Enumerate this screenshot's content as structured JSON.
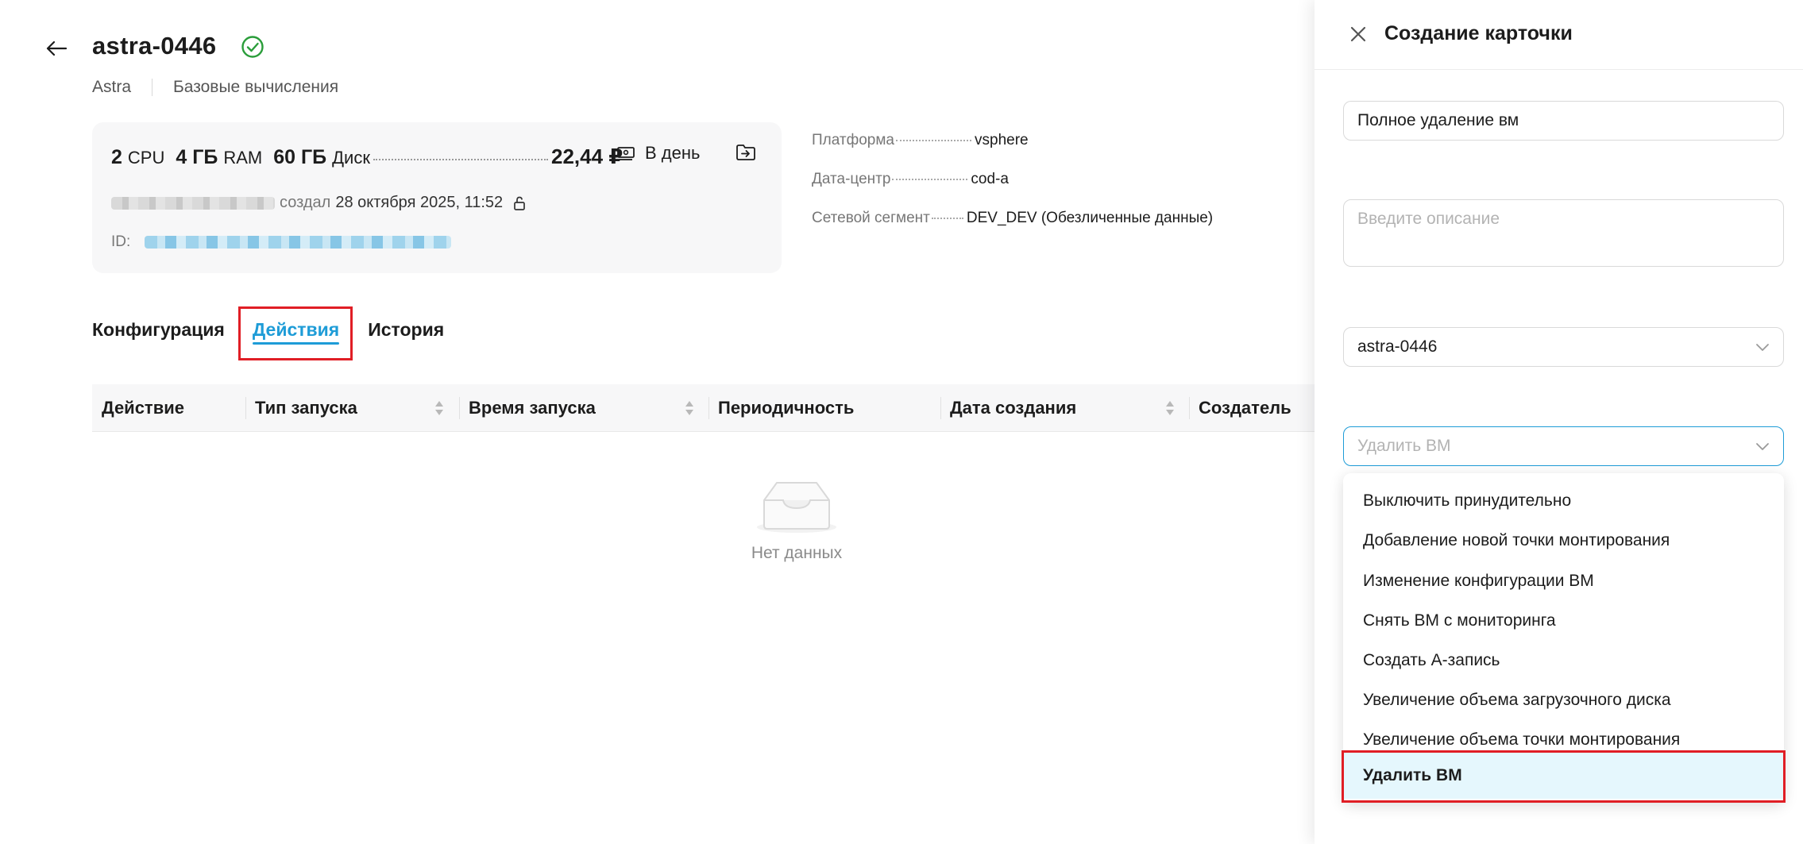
{
  "header": {
    "title": "astra-0446",
    "breadcrumb": [
      "Astra",
      "Базовые вычисления"
    ]
  },
  "card": {
    "cpu_value": "2",
    "cpu_unit": "CPU",
    "ram_value": "4 ГБ",
    "ram_unit": "RAM",
    "disk_value": "60 ГБ",
    "disk_unit": "Диск",
    "price": "22,44 ₽",
    "period": "В день",
    "created_label": "создал",
    "created_date": "28 октября 2025, 11:52",
    "id_label": "ID:"
  },
  "properties": [
    {
      "key": "Платформа",
      "value": "vsphere"
    },
    {
      "key": "Дата-центр",
      "value": "cod-a"
    },
    {
      "key": "Сетевой сегмент",
      "value": "DEV_DEV (Обезличенные данные)"
    }
  ],
  "tabs": [
    "Конфигурация",
    "Действия",
    "История"
  ],
  "active_tab": "Действия",
  "table": {
    "columns": [
      "Действие",
      "Тип запуска",
      "Время запуска",
      "Периодичность",
      "Дата создания",
      "Создатель"
    ],
    "empty_text": "Нет данных"
  },
  "panel": {
    "title": "Создание карточки",
    "name_value": "Полное удаление вм",
    "description_placeholder": "Введите описание",
    "vm_select_value": "astra-0446",
    "action_select_placeholder": "Удалить ВМ",
    "options": [
      "Выключить принудительно",
      "Добавление новой точки монтирования",
      "Изменение конфигурации ВМ",
      "Снять ВМ с мониторинга",
      "Создать А-запись",
      "Увеличение объема загрузочного диска",
      "Увеличение объема точки монтирования",
      "Удалить ВМ"
    ],
    "selected_option": "Удалить ВМ"
  },
  "colors": {
    "accent": "#1e9cd7",
    "highlight": "#e01e25",
    "success": "#2a9d3a",
    "selected_bg": "#e5f7fd"
  }
}
